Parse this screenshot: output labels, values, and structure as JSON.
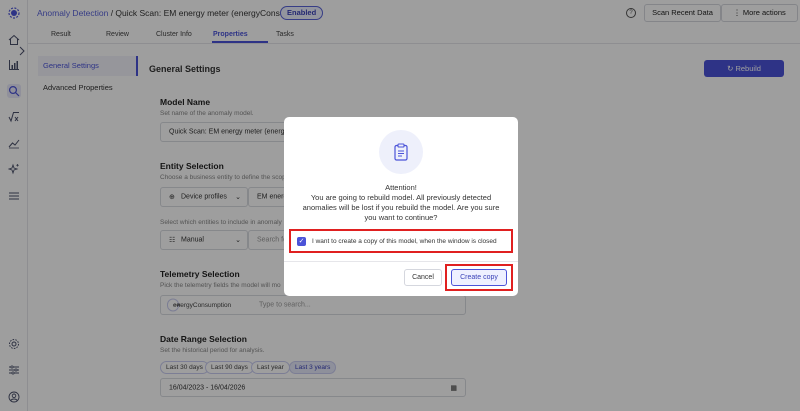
{
  "header": {
    "breadcrumb_link": "Anomaly Detection",
    "breadcrumb_rest": " / Quick Scan: EM energy meter (energyConsumption)",
    "status_badge": "Enabled",
    "help_icon": "?",
    "scan_button": "Scan Recent Data",
    "more_actions": "More actions"
  },
  "tabs": [
    "Result",
    "Review",
    "Cluster Info",
    "Properties",
    "Tasks"
  ],
  "active_tab": "Properties",
  "settings_nav": [
    "General Settings",
    "Advanced Properties"
  ],
  "main": {
    "title": "General Settings",
    "rebuild_button": "Rebuild",
    "model_name": {
      "title": "Model Name",
      "hint": "Set name of the anomaly model.",
      "value": "Quick Scan: EM energy meter (energy"
    },
    "entity_selection": {
      "title": "Entity Selection",
      "hint": "Choose a business entity to define the scop",
      "source": "Device profiles",
      "profile": "EM energ",
      "hint2": "Select which entities to include in anomaly",
      "mode": "Manual",
      "search_placeholder": "Search fo"
    },
    "telemetry": {
      "title": "Telemetry Selection",
      "hint": "Pick the telemetry fields the model will mo",
      "chip": "energyConsumption",
      "placeholder": "Type to search..."
    },
    "date_range": {
      "title": "Date Range Selection",
      "hint": "Set the historical period for analysis.",
      "presets": [
        "Last 30 days",
        "Last 90 days",
        "Last year",
        "Last 3 years"
      ],
      "selected_preset": "Last 3 years",
      "value": "16/04/2023 - 16/04/2026"
    }
  },
  "modal": {
    "title": "Attention!",
    "message": "You are going to rebuild model. All previously detected anomalies will be lost if you rebuild the model. Are you sure you want to continue?",
    "checkbox_label": "I want to create a copy of this model, when the window is closed",
    "checkbox_checked": true,
    "cancel": "Cancel",
    "create_copy": "Create copy"
  },
  "colors": {
    "accent": "#4b53d8",
    "highlight": "#e02020"
  }
}
